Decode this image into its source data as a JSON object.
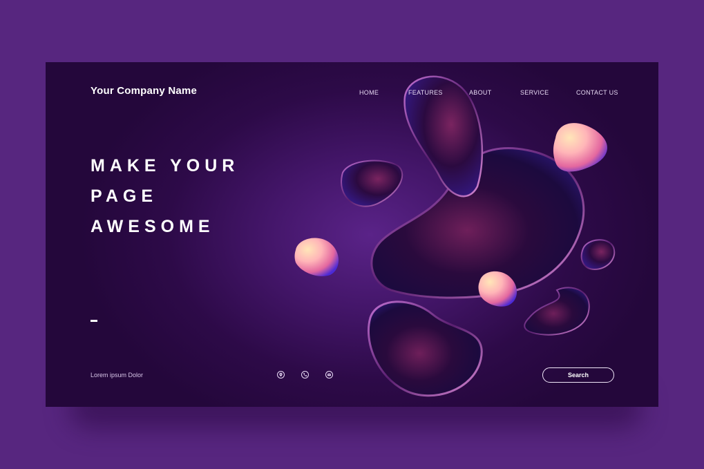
{
  "header": {
    "company_name": "Your Company Name",
    "nav": [
      "HOME",
      "FEATURES",
      "ABOUT",
      "SERVICE",
      "CONTACT US"
    ]
  },
  "hero": {
    "lines": [
      "MAKE YOUR",
      "PAGE",
      "AWESOME"
    ]
  },
  "footer": {
    "text": "Lorem ipsum Dolor",
    "icons": [
      "location-pin-icon",
      "phone-icon",
      "message-icon"
    ],
    "search_label": "Search"
  },
  "colors": {
    "page_background": "#57267f",
    "card_background": "#2d0a48",
    "accent_pink": "#ffc9a8",
    "accent_blue": "#4b2ad6"
  }
}
